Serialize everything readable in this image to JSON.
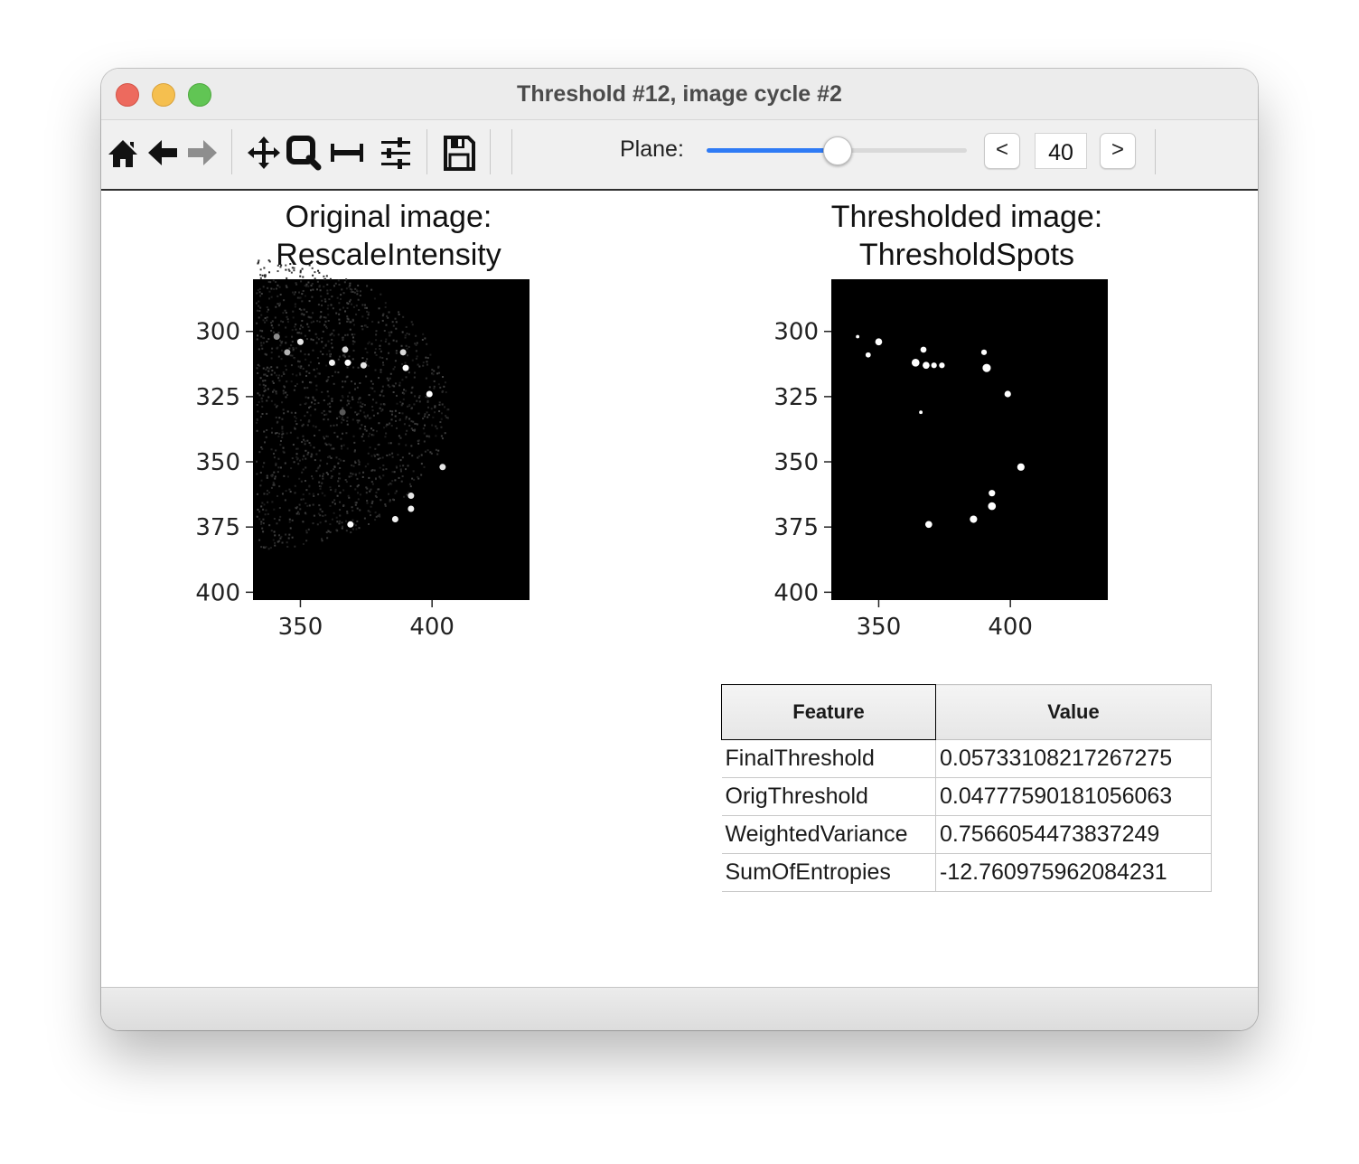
{
  "window": {
    "title": "Threshold #12, image cycle #2"
  },
  "toolbar": {
    "icons": [
      "home-icon",
      "back-icon",
      "forward-icon",
      "pan-icon",
      "zoom-icon",
      "subplots-icon",
      "configure-icon",
      "save-icon"
    ],
    "plane_label": "Plane:",
    "prev_label": "<",
    "next_label": ">",
    "plane_value": "40",
    "slider_fraction": 0.5,
    "slider_accent": "#2f7bf5"
  },
  "chart_data": [
    {
      "type": "image",
      "title": "Original image:\nRescaleIntensity",
      "xticks": [
        350,
        400
      ],
      "yticks": [
        300,
        325,
        350,
        375,
        400
      ],
      "xlim": [
        332,
        437
      ],
      "ylim": [
        403,
        280
      ],
      "colormap": "gray",
      "spots": [
        {
          "x": 341,
          "y": 302,
          "v": 0.55
        },
        {
          "x": 350,
          "y": 304,
          "v": 0.9
        },
        {
          "x": 345,
          "y": 308,
          "v": 0.7
        },
        {
          "x": 367,
          "y": 307,
          "v": 0.85
        },
        {
          "x": 389,
          "y": 308,
          "v": 0.85
        },
        {
          "x": 362,
          "y": 312,
          "v": 0.95
        },
        {
          "x": 368,
          "y": 312,
          "v": 1.0
        },
        {
          "x": 374,
          "y": 313,
          "v": 0.9
        },
        {
          "x": 390,
          "y": 314,
          "v": 1.0
        },
        {
          "x": 399,
          "y": 324,
          "v": 1.0
        },
        {
          "x": 366,
          "y": 331,
          "v": 0.35
        },
        {
          "x": 404,
          "y": 352,
          "v": 0.9
        },
        {
          "x": 392,
          "y": 363,
          "v": 0.9
        },
        {
          "x": 392,
          "y": 368,
          "v": 0.95
        },
        {
          "x": 386,
          "y": 372,
          "v": 0.95
        },
        {
          "x": 369,
          "y": 374,
          "v": 1.0
        }
      ]
    },
    {
      "type": "image",
      "title": "Thresholded image:\nThresholdSpots",
      "xticks": [
        350,
        400
      ],
      "yticks": [
        300,
        325,
        350,
        375,
        400
      ],
      "xlim": [
        332,
        437
      ],
      "ylim": [
        403,
        280
      ],
      "colormap": "binary",
      "spots": [
        {
          "x": 342,
          "y": 302,
          "r": 0.8
        },
        {
          "x": 350,
          "y": 304,
          "r": 1.6
        },
        {
          "x": 346,
          "y": 309,
          "r": 1.2
        },
        {
          "x": 367,
          "y": 307,
          "r": 1.4
        },
        {
          "x": 364,
          "y": 312,
          "r": 1.8
        },
        {
          "x": 368,
          "y": 313,
          "r": 1.6
        },
        {
          "x": 374,
          "y": 313,
          "r": 1.3
        },
        {
          "x": 371,
          "y": 313,
          "r": 1.3
        },
        {
          "x": 390,
          "y": 308,
          "r": 1.3
        },
        {
          "x": 391,
          "y": 314,
          "r": 1.9
        },
        {
          "x": 399,
          "y": 324,
          "r": 1.5
        },
        {
          "x": 366,
          "y": 331,
          "r": 0.8
        },
        {
          "x": 404,
          "y": 352,
          "r": 1.7
        },
        {
          "x": 393,
          "y": 362,
          "r": 1.5
        },
        {
          "x": 393,
          "y": 367,
          "r": 1.8
        },
        {
          "x": 386,
          "y": 372,
          "r": 1.7
        },
        {
          "x": 369,
          "y": 374,
          "r": 1.6
        }
      ]
    }
  ],
  "table": {
    "headers": [
      "Feature",
      "Value"
    ],
    "rows": [
      [
        "FinalThreshold",
        "0.05733108217267275"
      ],
      [
        "OrigThreshold",
        "0.04777590181056063"
      ],
      [
        "WeightedVariance",
        "0.7566054473837249"
      ],
      [
        "SumOfEntropies",
        "-12.760975962084231"
      ]
    ]
  }
}
